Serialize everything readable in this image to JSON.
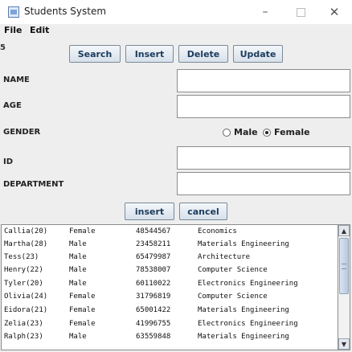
{
  "window": {
    "title": "Students System",
    "icon": "java-app-icon",
    "minimize": "–",
    "close": "✕"
  },
  "menu": {
    "file": "File",
    "edit": "Edit"
  },
  "side_mark": "5",
  "toolbar": {
    "search": "Search",
    "insert": "Insert",
    "delete": "Delete",
    "update": "Update"
  },
  "form": {
    "name_label": "NAME",
    "age_label": "AGE",
    "gender_label": "GENDER",
    "id_label": "ID",
    "department_label": "DEPARTMENT",
    "name_value": "",
    "age_value": "",
    "id_value": "",
    "department_value": "",
    "gender_male": "Male",
    "gender_female": "Female",
    "gender_selected": "Female",
    "insert_button": "insert",
    "cancel_button": "cancel"
  },
  "students": [
    {
      "name": "Callia(20)",
      "gender": "Female",
      "id": "48544567",
      "department": "Economics"
    },
    {
      "name": "Martha(28)",
      "gender": "Male",
      "id": "23458211",
      "department": "Materials Engineering"
    },
    {
      "name": "Tess(23)",
      "gender": "Male",
      "id": "65479987",
      "department": "Architecture"
    },
    {
      "name": "Henry(22)",
      "gender": "Male",
      "id": "78538007",
      "department": "Computer Science"
    },
    {
      "name": "Tyler(20)",
      "gender": "Male",
      "id": "60110022",
      "department": "Electronics Engineering"
    },
    {
      "name": "Olivia(24)",
      "gender": "Female",
      "id": "31796819",
      "department": "Computer Science"
    },
    {
      "name": "Eidora(21)",
      "gender": "Female",
      "id": "65001422",
      "department": "Materials Engineering"
    },
    {
      "name": "Zelia(23)",
      "gender": "Female",
      "id": "41996755",
      "department": "Electronics Engineering"
    },
    {
      "name": "Ralph(23)",
      "gender": "Male",
      "id": "63559848",
      "department": "Materials Engineering"
    }
  ],
  "scrollbar": {
    "up_icon": "▲",
    "down_icon": "▼"
  }
}
